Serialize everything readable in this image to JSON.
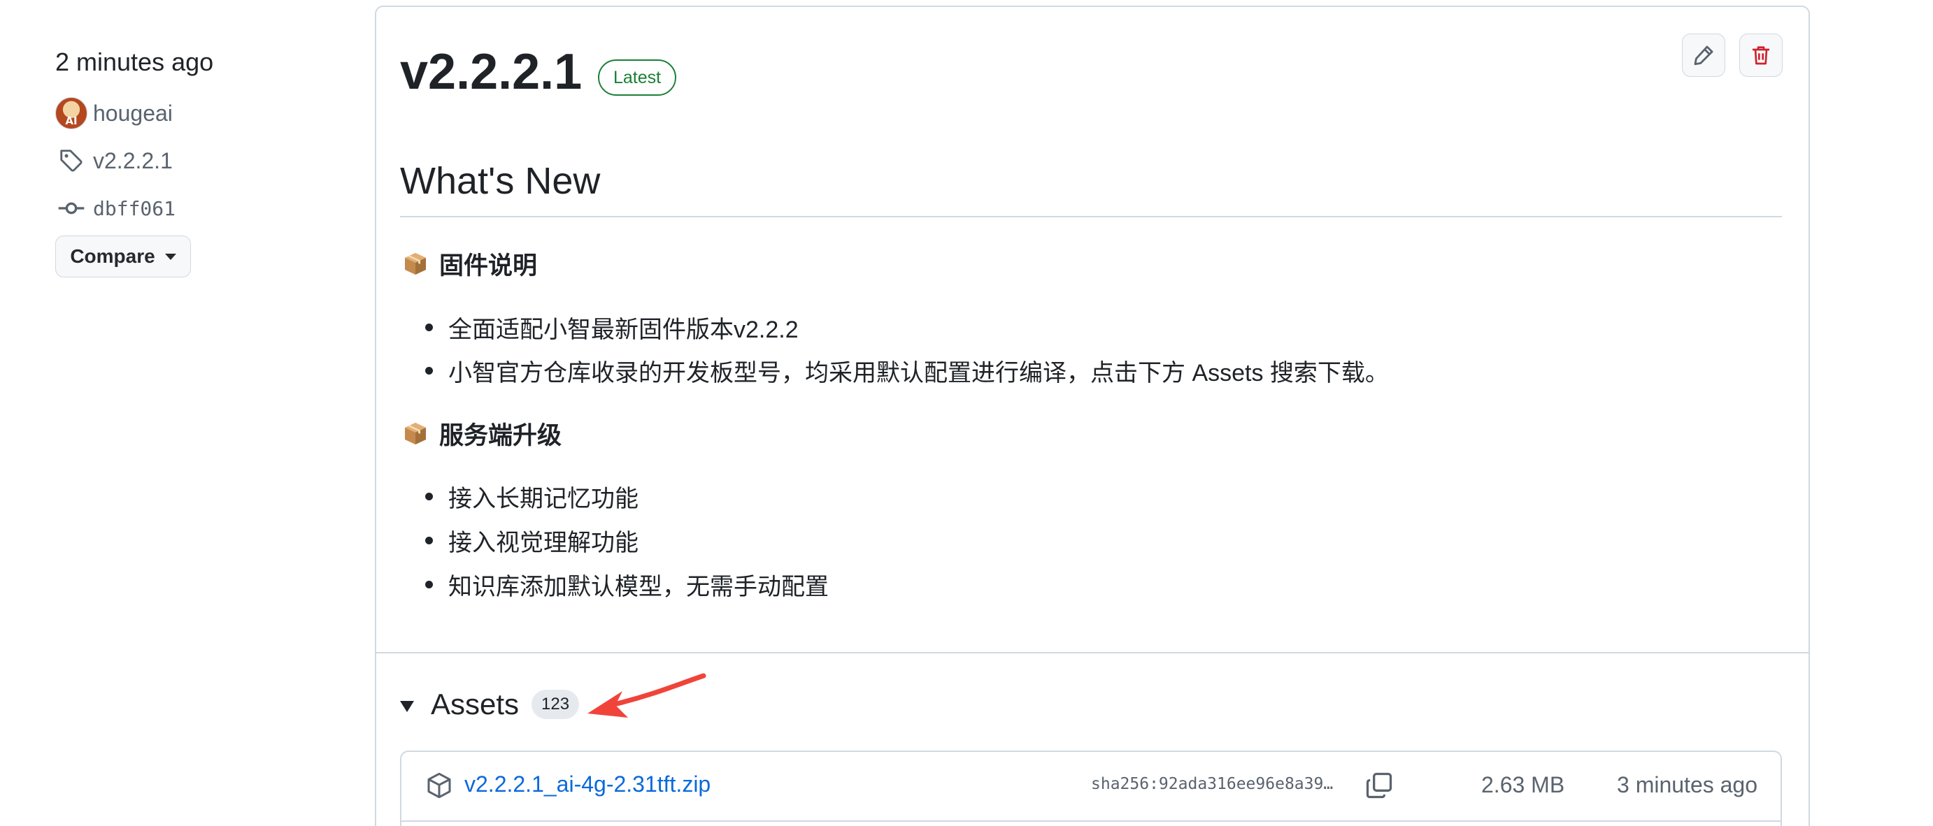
{
  "sidebar": {
    "time": "2 minutes ago",
    "author": "hougeai",
    "avatar_text": "AI",
    "tag": "v2.2.2.1",
    "commit": "dbff061",
    "compare_label": "Compare"
  },
  "release": {
    "title": "v2.2.2.1",
    "badge": "Latest",
    "body": {
      "heading": "What's New",
      "sections": [
        {
          "emoji_icon": "package-icon",
          "title": "固件说明",
          "items": [
            "全面适配小智最新固件版本v2.2.2",
            "小智官方仓库收录的开发板型号，均采用默认配置进行编译，点击下方 Assets 搜索下载。"
          ]
        },
        {
          "emoji_icon": "package-icon",
          "title": "服务端升级",
          "items": [
            "接入长期记忆功能",
            "接入视觉理解功能",
            "知识库添加默认模型，无需手动配置"
          ]
        }
      ]
    }
  },
  "assets": {
    "label": "Assets",
    "count": "123",
    "files": [
      {
        "name": "v2.2.2.1_ai-4g-2.31tft.zip",
        "sha": "sha256:92ada316ee96e8a39…",
        "size": "2.63 MB",
        "date": "3 minutes ago"
      }
    ]
  },
  "colors": {
    "link": "#0969da",
    "latest_green": "#1a7f37",
    "danger_red": "#cf222e",
    "annotation_red": "#f0443a"
  }
}
